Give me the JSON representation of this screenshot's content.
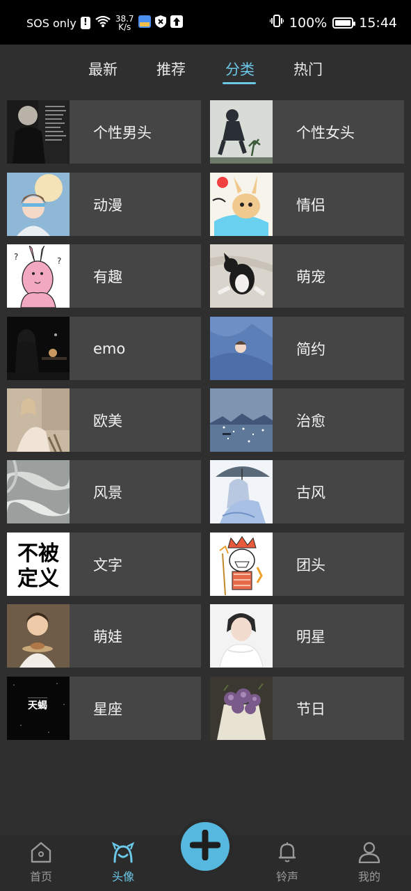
{
  "status_bar": {
    "carrier": "SOS only",
    "net_speed_value": "38.7",
    "net_speed_unit": "K/s",
    "battery": "100%",
    "time": "15:44"
  },
  "tabs": [
    {
      "label": "最新",
      "active": false
    },
    {
      "label": "推荐",
      "active": false
    },
    {
      "label": "分类",
      "active": true
    },
    {
      "label": "热门",
      "active": false
    }
  ],
  "categories": [
    {
      "label": "个性男头"
    },
    {
      "label": "个性女头"
    },
    {
      "label": "动漫"
    },
    {
      "label": "情侣"
    },
    {
      "label": "有趣"
    },
    {
      "label": "萌宠"
    },
    {
      "label": "emo"
    },
    {
      "label": "简约"
    },
    {
      "label": "欧美"
    },
    {
      "label": "治愈"
    },
    {
      "label": "风景"
    },
    {
      "label": "古风"
    },
    {
      "label": "文字"
    },
    {
      "label": "团头"
    },
    {
      "label": "萌娃"
    },
    {
      "label": "明星"
    },
    {
      "label": "星座"
    },
    {
      "label": "节日"
    }
  ],
  "thumb_text": {
    "text_card": "不被定义",
    "constellation": "天蝎"
  },
  "bottom_nav": [
    {
      "label": "首页",
      "icon": "home-icon",
      "active": false
    },
    {
      "label": "头像",
      "icon": "avatar-face-icon",
      "active": true
    },
    {
      "label": "铃声",
      "icon": "bell-icon",
      "active": false
    },
    {
      "label": "我的",
      "icon": "user-icon",
      "active": false
    }
  ],
  "colors": {
    "accent": "#6cc8e8",
    "background": "#2f2f2f",
    "card": "#454545",
    "fab": "#56b8de"
  }
}
